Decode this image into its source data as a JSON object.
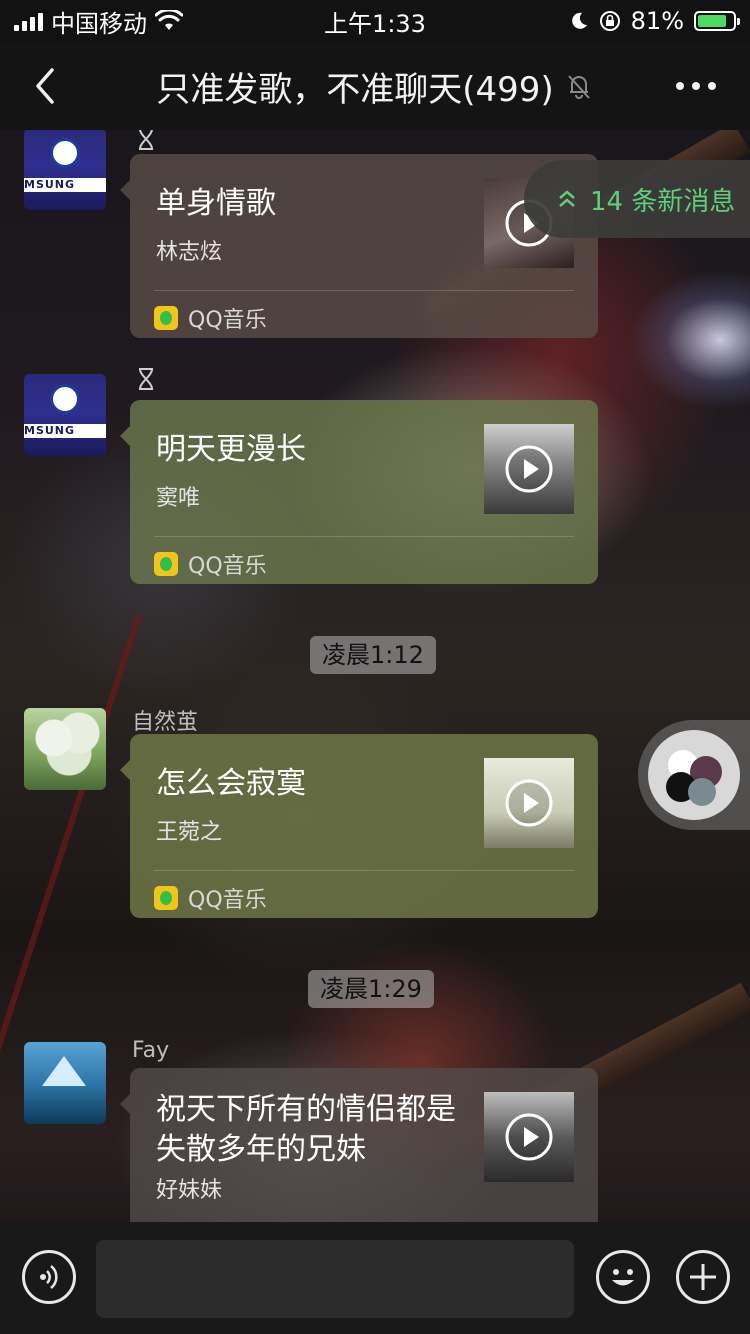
{
  "status_bar": {
    "carrier": "中国移动",
    "time": "上午1:33",
    "battery_percent": "81%"
  },
  "nav": {
    "title": "只准发歌，不准聊天(499)"
  },
  "new_messages": {
    "label": "14 条新消息"
  },
  "messages": [
    {
      "sender": "",
      "song_title": "单身情歌",
      "artist": "林志炫",
      "source": "QQ音乐",
      "cover_icon": "play-icon"
    },
    {
      "sender": "",
      "song_title": "明天更漫长",
      "artist": "窦唯",
      "source": "QQ音乐",
      "cover_icon": "play-icon"
    },
    {
      "sender": "自然茧",
      "song_title": "怎么会寂寞",
      "artist": "王菀之",
      "source": "QQ音乐",
      "cover_icon": "play-icon"
    },
    {
      "sender": "Fay",
      "song_title": "祝天下所有的情侣都是失散多年的兄妹",
      "artist": "好妹妹",
      "source": "",
      "cover_icon": "play-icon"
    }
  ],
  "timestamps": [
    "凌晨1:12",
    "凌晨1:29"
  ],
  "input": {
    "placeholder": ""
  },
  "colors": {
    "accent_green": "#5fcf7a",
    "battery_green": "#4cd964",
    "qq_yellow": "#f3c51b"
  }
}
